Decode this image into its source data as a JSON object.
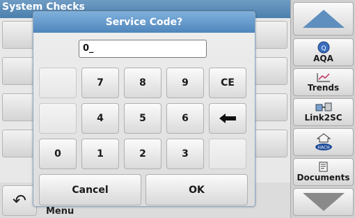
{
  "background": {
    "title": "System Checks",
    "menu_label": "Menu"
  },
  "sidebar": {
    "items": [
      {
        "label": "AQA",
        "icon": "aqa-icon"
      },
      {
        "label": "Trends",
        "icon": "trends-chart-icon"
      },
      {
        "label": "Link2SC",
        "icon": "link2sc-icon"
      },
      {
        "label": "",
        "icon": "home-hach-icon"
      },
      {
        "label": "Documents",
        "icon": "documents-icon"
      }
    ]
  },
  "dialog": {
    "title": "Service Code?",
    "input_value": "0_",
    "keys": {
      "k7": "7",
      "k8": "8",
      "k9": "9",
      "ce": "CE",
      "k4": "4",
      "k5": "5",
      "k6": "6",
      "k0": "0",
      "k1": "1",
      "k2": "2",
      "k3": "3"
    },
    "cancel_label": "Cancel",
    "ok_label": "OK"
  },
  "colors": {
    "title_bar": "#5b8fc2",
    "accent_up": "#5f8fbf"
  }
}
